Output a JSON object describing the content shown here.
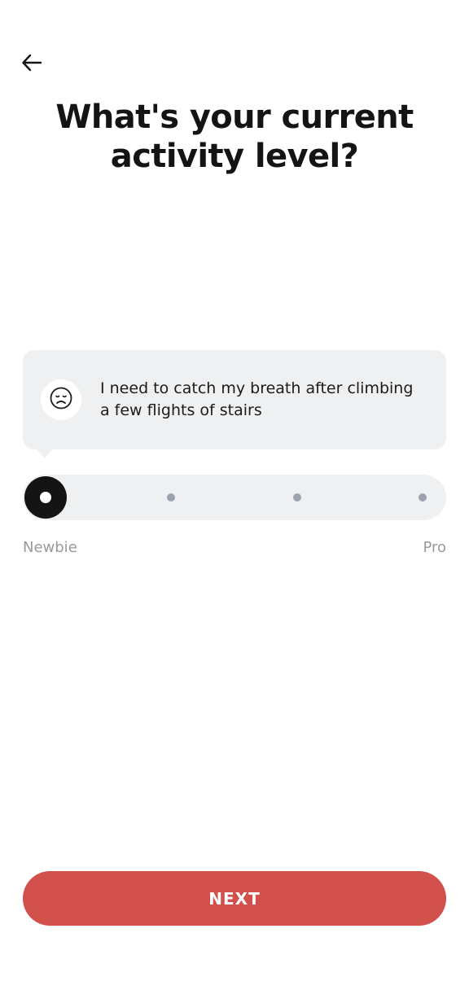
{
  "header": {
    "back_icon": "arrow-left-icon"
  },
  "title": "What's your current activity level?",
  "selection": {
    "mood_icon": "sad-face-icon",
    "description": "I need to catch my breath after climbing a few flights of stairs"
  },
  "slider": {
    "steps": 4,
    "selected_index": 0,
    "min_label": "Newbie",
    "max_label": "Pro"
  },
  "footer": {
    "next_label": "NEXT"
  },
  "colors": {
    "accent": "#d1504b",
    "surface": "#eff0f2",
    "thumb": "#141414",
    "inactive_dot": "#9da2b0"
  }
}
